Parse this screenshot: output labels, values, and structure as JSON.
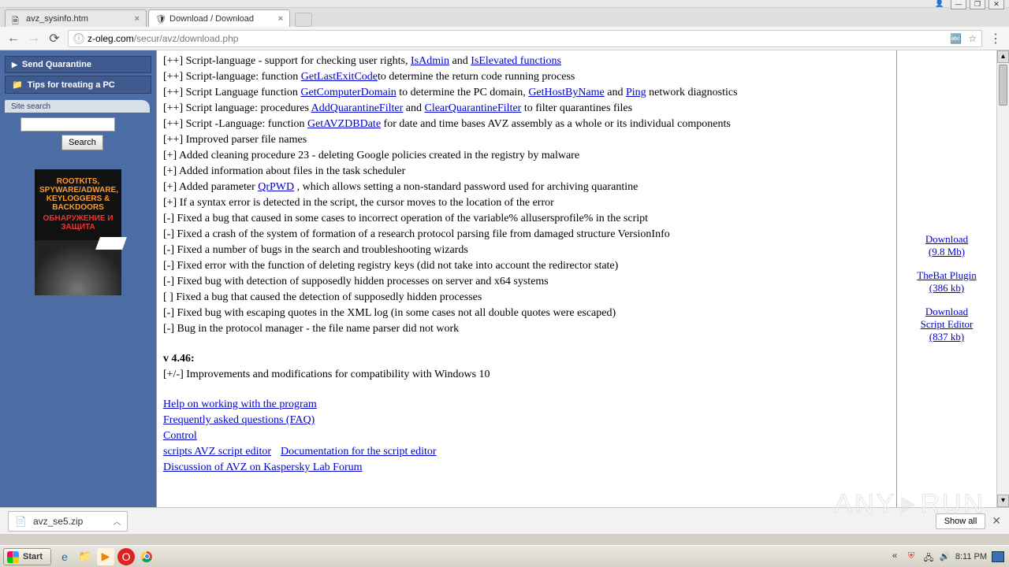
{
  "window_buttons": {
    "user": "👤",
    "min": "—",
    "max": "❐",
    "close": "✕"
  },
  "tabs": [
    {
      "title": "avz_sysinfo.htm",
      "active": false
    },
    {
      "title": "Download / Download",
      "active": true
    }
  ],
  "nav": {
    "back": "←",
    "forward": "→",
    "reload": "⟳"
  },
  "url": {
    "info": "ⓘ",
    "host": "z-oleg.com",
    "path": "/secur/avz/download.php"
  },
  "omni": {
    "translate": "🔤",
    "star": "☆",
    "menu": "⋮"
  },
  "sidebar": {
    "send": "Send Quarantine",
    "tips": "Tips for treating a PC",
    "site_search_label": "Site search",
    "search_btn": "Search",
    "book": {
      "line1": "ROOTKITS,",
      "line2": "SPYWARE/ADWARE,",
      "line3": "KEYLOGGERS &",
      "line4": "BACKDOORS",
      "red": "ОБНАРУЖЕНИЕ И ЗАЩИТА"
    }
  },
  "changelog": [
    {
      "pre": "[++] Script-language - support for checking user rights, ",
      "links": [
        {
          "t": "IsAdmin"
        }
      ],
      "mid": " and ",
      "links2": [
        {
          "t": "IsElevated functions"
        }
      ],
      "post": ""
    },
    {
      "pre": "[++] Script-language: function ",
      "links": [
        {
          "t": "GetLastExitCode"
        }
      ],
      "post": "to determine the return code running process"
    },
    {
      "pre": "[++] Script Language function ",
      "links": [
        {
          "t": "GetComputerDomain"
        }
      ],
      "mid": " to determine the PC domain, ",
      "links2": [
        {
          "t": "GetHostByName"
        }
      ],
      "mid2": " and ",
      "links3": [
        {
          "t": "Ping"
        }
      ],
      "post": " network diagnostics"
    },
    {
      "pre": "[++] Script language: procedures ",
      "links": [
        {
          "t": "AddQuarantineFilter"
        }
      ],
      "mid": " and ",
      "links2": [
        {
          "t": "ClearQuarantineFilter"
        }
      ],
      "post": " to filter quarantines files"
    },
    {
      "pre": "[++] Script -Language: function ",
      "links": [
        {
          "t": "GetAVZDBDate"
        }
      ],
      "post": " for date and time bases AVZ assembly as a whole or its individual components"
    },
    {
      "pre": "[++] Improved parser file names"
    },
    {
      "pre": "[+] Added cleaning procedure 23 - deleting Google policies created in the registry by malware"
    },
    {
      "pre": "[+] Added information about files in the task scheduler"
    },
    {
      "pre": "[+] Added parameter ",
      "links": [
        {
          "t": "QrPWD"
        }
      ],
      "post": " , which allows setting a non-standard password used for archiving quarantine"
    },
    {
      "pre": "[+] If a syntax error is detected in the script, the cursor moves to the location of the error"
    },
    {
      "pre": "[-] Fixed a bug that caused in some cases to incorrect operation of the variable% allusersprofile% in the script"
    },
    {
      "pre": "[-] Fixed a crash of the system of formation of a research protocol parsing file from damaged structure VersionInfo"
    },
    {
      "pre": "[-] Fixed a number of bugs in the search and troubleshooting wizards"
    },
    {
      "pre": "[-] Fixed error with the function of deleting registry keys (did not take into account the redirector state)"
    },
    {
      "pre": "[-] Fixed bug with detection of supposedly hidden processes on server and x64 systems"
    },
    {
      "pre": "[ ] Fixed a bug that caused the detection of supposedly hidden processes"
    },
    {
      "pre": "[-] Fixed bug with escaping quotes in the XML log (in some cases not all double quotes were escaped)"
    },
    {
      "pre": "[-] Bug in the protocol manager - the file name parser did not work"
    }
  ],
  "version_header": "v 4.46:",
  "version_line": "[+/-] Improvements and modifications for compatibility with Windows 10",
  "bottom_links": [
    "Help on working with the program ",
    "Frequently asked questions (FAQ) ",
    "Control ",
    "scripts AVZ script editor ",
    "Documentation for the script editor ",
    "Discussion of AVZ on Kaspersky Lab Forum"
  ],
  "right": {
    "dl1a": "Download",
    "dl1b": "(9.8 Mb)",
    "dl2a": "TheBat Plugin",
    "dl2b": "(386 kb)",
    "dl3a": "Download",
    "dl3b": "Script Editor",
    "dl3c": "(837 kb)"
  },
  "download_bar": {
    "file": "avz_se5.zip",
    "showall": "Show all",
    "close": "✕"
  },
  "taskbar": {
    "start": "Start",
    "clock": "8:11 PM"
  },
  "watermark": {
    "a": "ANY",
    "b": "RUN"
  }
}
